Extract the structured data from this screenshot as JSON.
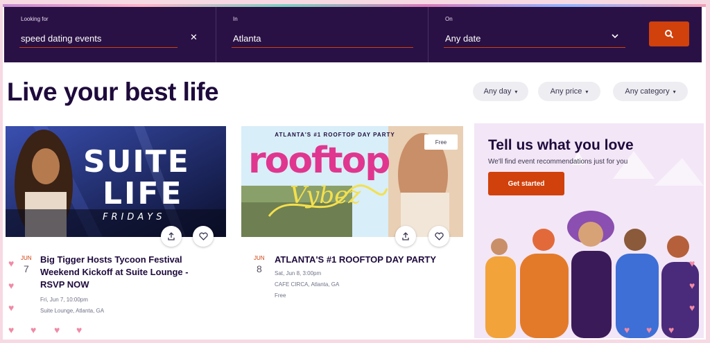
{
  "search": {
    "looking_for": {
      "label": "Looking for",
      "value": "speed dating events",
      "clear_icon": "close-icon"
    },
    "in": {
      "label": "In",
      "value": "Atlanta"
    },
    "on": {
      "label": "On",
      "value": "Any date",
      "icon": "chevron-down-icon"
    },
    "button_icon": "search-icon",
    "accent": "#d1410c",
    "background": "#2a1145"
  },
  "hero": {
    "title": "Live your best life"
  },
  "filters": [
    {
      "label": "Any day"
    },
    {
      "label": "Any price"
    },
    {
      "label": "Any category"
    }
  ],
  "events": [
    {
      "image_text": [
        "SUITE",
        "LIFE",
        "FRIDAYS"
      ],
      "month": "JUN",
      "day": "7",
      "title_lines": [
        "Big Tigger Hosts Tycoon Festival",
        "Weekend Kickoff at Suite Lounge -",
        "RSVP NOW"
      ],
      "datetime": "Fri, Jun 7, 10:00pm",
      "venue": "Suite Lounge, Atlanta, GA",
      "price": ""
    },
    {
      "image_text": [
        "ATLANTA'S #1 ROOFTOP DAY PARTY",
        "rooftop",
        "Vybez"
      ],
      "badge": "Free",
      "month": "JUN",
      "day": "8",
      "title_lines": [
        "ATLANTA'S #1 ROOFTOP DAY PARTY"
      ],
      "datetime": "Sat, Jun 8, 3:00pm",
      "venue": "CAFE CIRCA, Atlanta, GA",
      "price": "Free"
    }
  ],
  "card_icons": [
    "share-icon",
    "heart-icon"
  ],
  "promo": {
    "title": "Tell us what you love",
    "subtitle": "We'll find event recommendations just for you",
    "button": "Get started",
    "background": "#f3e6f6"
  }
}
